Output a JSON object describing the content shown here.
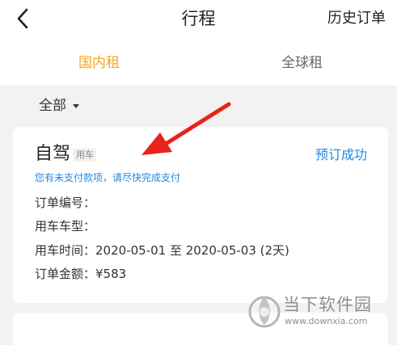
{
  "header": {
    "title": "行程",
    "history_label": "历史订单",
    "back_icon": "chevron-left-icon"
  },
  "tabs": [
    {
      "label": "国内租",
      "active": true
    },
    {
      "label": "全球租",
      "active": false
    }
  ],
  "filter": {
    "label": "全部",
    "icon": "caret-down-icon"
  },
  "order": {
    "title": "自驾",
    "tag": "用车",
    "status": "预订成功",
    "notice": "您有未支付款项，请尽快完成支付",
    "fields": [
      {
        "label": "订单编号：",
        "value": ""
      },
      {
        "label": "用车车型：",
        "value": ""
      },
      {
        "label": "用车时间：",
        "value": "2020-05-01 至 2020-05-03 (2天)"
      },
      {
        "label": "订单金额：",
        "value": "¥583"
      }
    ]
  },
  "watermark": {
    "name": "当下软件园",
    "url": "www.downxia.com"
  },
  "colors": {
    "accent": "#f5a623",
    "link": "#1e88e5",
    "arrow": "#e8231a",
    "background": "#f2f2f2"
  }
}
